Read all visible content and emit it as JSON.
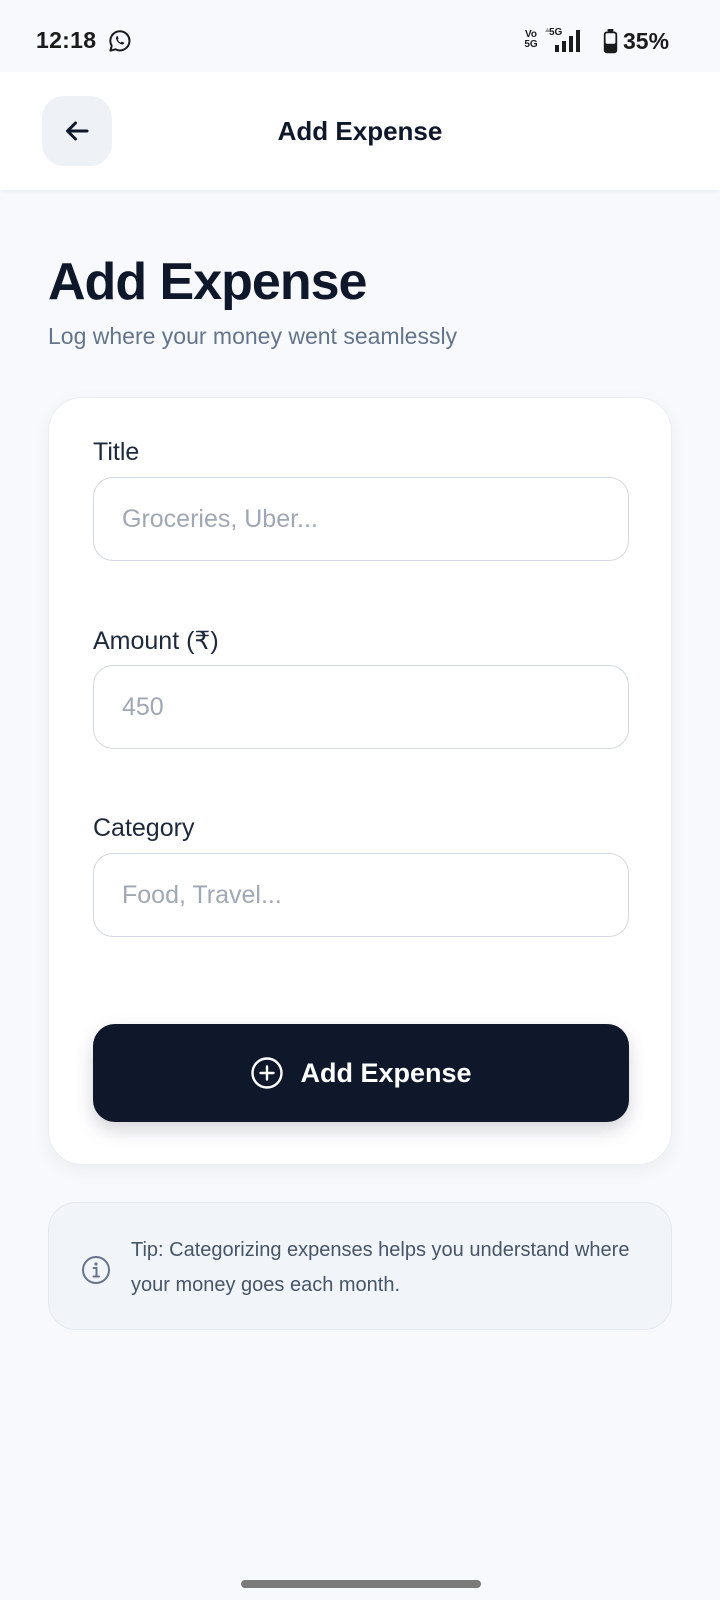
{
  "status_bar": {
    "time": "12:18",
    "volte_line1": "Vo",
    "volte_line2": "5G",
    "network": "5G",
    "battery_percent": "35%",
    "battery_level": 0.35,
    "notification_icon": "whatsapp-icon"
  },
  "header": {
    "back_icon": "arrow-left-icon",
    "title": "Add Expense"
  },
  "page": {
    "title": "Add Expense",
    "subtitle": "Log where your money went seamlessly"
  },
  "form": {
    "title_field": {
      "label": "Title",
      "value": "",
      "placeholder": "Groceries, Uber..."
    },
    "amount_field": {
      "label": "Amount (₹)",
      "value": "",
      "placeholder": "450"
    },
    "category_field": {
      "label": "Category",
      "value": "",
      "placeholder": "Food, Travel..."
    },
    "submit": {
      "icon": "plus-circle-icon",
      "label": "Add Expense"
    }
  },
  "tip": {
    "icon": "info-icon",
    "text": "Tip: Categorizing expenses helps you understand where your money goes each month."
  },
  "colors": {
    "background": "#f7f9fc",
    "surface": "#ffffff",
    "primary": "#0f172a",
    "muted_text": "#64748b",
    "placeholder": "#a0a8b4",
    "tip_background": "#f1f5f9"
  }
}
